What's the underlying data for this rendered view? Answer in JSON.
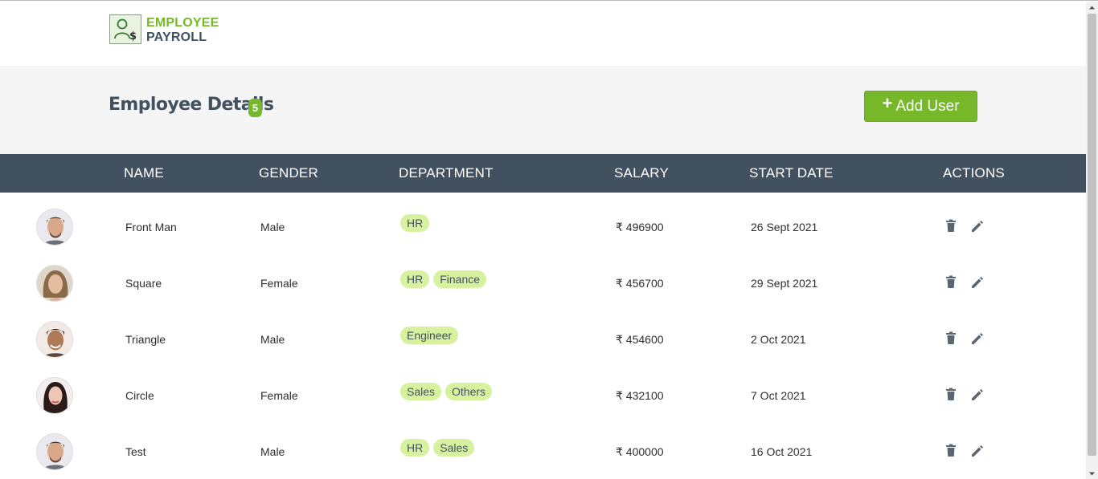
{
  "app": {
    "brand_line1": "EMPLOYEE",
    "brand_line2": "PAYROLL"
  },
  "page": {
    "title": "Employee Details",
    "count": "5",
    "add_button_label": "Add User"
  },
  "table": {
    "columns": [
      "NAME",
      "GENDER",
      "DEPARTMENT",
      "SALARY",
      "START DATE",
      "ACTIONS"
    ],
    "rows": [
      {
        "name": "Front Man",
        "gender": "Male",
        "departments": [
          "HR"
        ],
        "salary": "₹ 496900",
        "start_date": "26 Sept 2021",
        "avatar": "male-avatar-1"
      },
      {
        "name": "Square",
        "gender": "Female",
        "departments": [
          "HR",
          "Finance"
        ],
        "salary": "₹ 456700",
        "start_date": "29 Sept 2021",
        "avatar": "female-avatar-1"
      },
      {
        "name": "Triangle",
        "gender": "Male",
        "departments": [
          "Engineer"
        ],
        "salary": "₹ 454600",
        "start_date": "2 Oct 2021",
        "avatar": "male-avatar-2"
      },
      {
        "name": "Circle",
        "gender": "Female",
        "departments": [
          "Sales",
          "Others"
        ],
        "salary": "₹ 432100",
        "start_date": "7 Oct 2021",
        "avatar": "female-avatar-2"
      },
      {
        "name": "Test",
        "gender": "Male",
        "departments": [
          "HR",
          "Sales"
        ],
        "salary": "₹ 400000",
        "start_date": "16 Oct 2021",
        "avatar": "male-avatar-1"
      }
    ]
  },
  "icons": {
    "logo": "employee-payroll-logo-icon",
    "add": "plus-icon",
    "delete": "trash-icon",
    "edit": "pencil-icon"
  },
  "colors": {
    "accent": "#76b82a",
    "header_dark": "#42515f",
    "chip_bg": "#d7f29e",
    "band_bg": "#f5f5f5"
  }
}
